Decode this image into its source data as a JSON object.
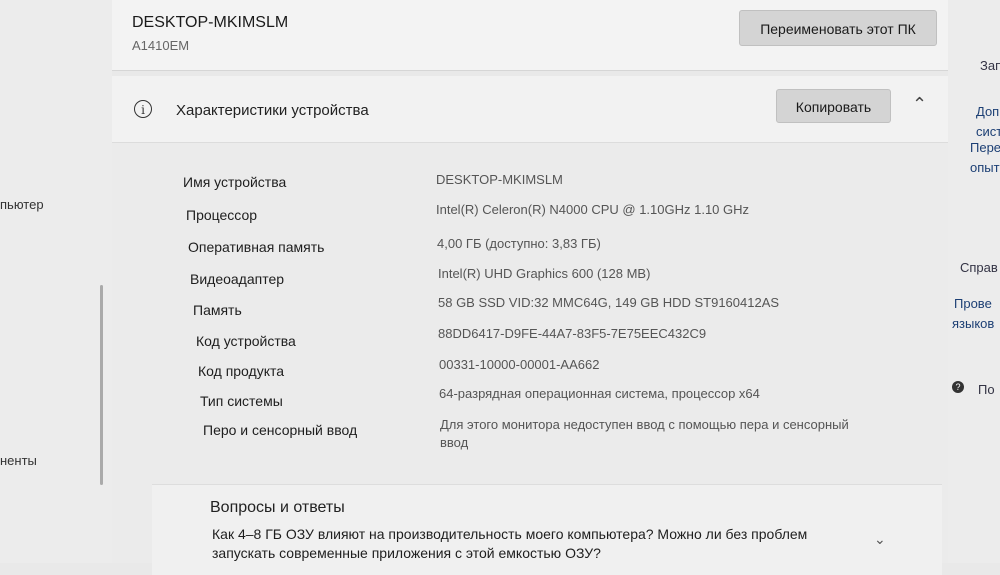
{
  "device": {
    "name": "DESKTOP-MKIMSLM",
    "model": "A1410EM",
    "rename_button": "Переименовать этот ПК"
  },
  "specs": {
    "title": "Характеристики устройства",
    "copy_button": "Копировать",
    "icon": "info-icon",
    "rows": [
      {
        "label": "Имя устройства",
        "value": "DESKTOP-MKIMSLM"
      },
      {
        "label": "Процессор",
        "value": "Intel(R) Celeron(R) N4000 CPU @ 1.10GHz   1.10 GHz"
      },
      {
        "label": "Оперативная память",
        "value": "4,00 ГБ (доступно: 3,83 ГБ)"
      },
      {
        "label": "Видеоадаптер",
        "value": "Intel(R) UHD Graphics 600 (128 MB)"
      },
      {
        "label": "Память",
        "value": "58 GB SSD VID:32 MMC64G, 149 GB HDD ST9160412AS"
      },
      {
        "label": "Код устройства",
        "value": "88DD6417-D9FE-44A7-83F5-7E75EEC432C9"
      },
      {
        "label": "Код продукта",
        "value": "00331-10000-00001-AA662"
      },
      {
        "label": "Тип системы",
        "value": "64-разрядная операционная система, процессор x64"
      },
      {
        "label": "Перо и сенсорный ввод",
        "value": "Для этого монитора недоступен ввод с помощью пера и сенсорный ввод"
      }
    ]
  },
  "faq": {
    "title": "Вопросы и ответы",
    "question": "Как 4–8 ГБ ОЗУ влияют на производительность моего компьютера? Можно ли без проблем запускать современные приложения с этой емкостью ОЗУ?"
  },
  "left_pane": {
    "items": [
      "пьютер",
      "",
      "ненты"
    ]
  },
  "right_pane": {
    "items": [
      "Зап",
      "Доп",
      "сист",
      "Пере",
      "опыт",
      "Справ",
      "Прове",
      "языков",
      "По"
    ]
  }
}
